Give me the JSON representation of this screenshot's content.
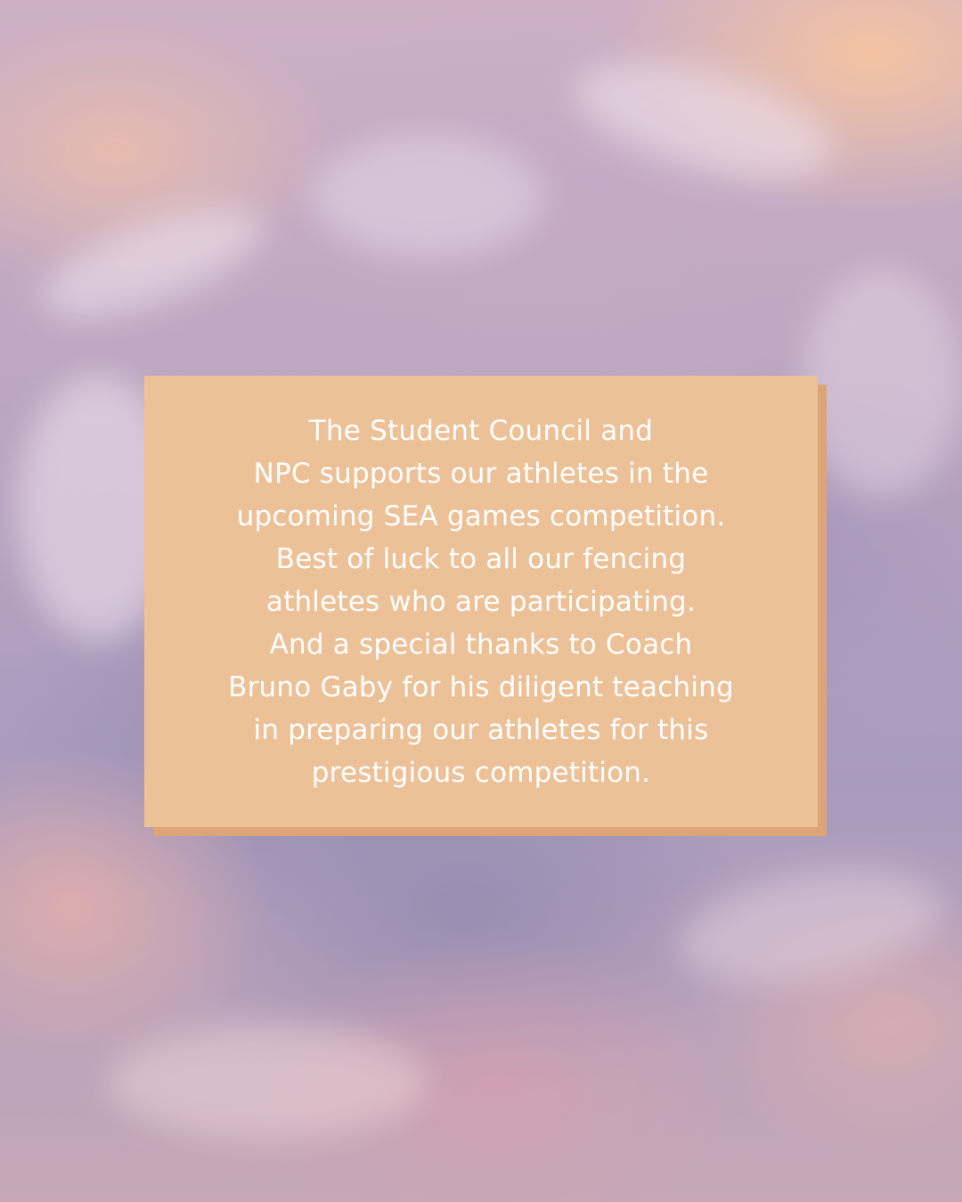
{
  "post": {
    "message_lines": [
      "The Student Council and",
      "NPC supports our athletes in the",
      "upcoming SEA games competition.",
      "Best of luck to all our fencing",
      "athletes who are participating.",
      "And a special thanks to Coach",
      "Bruno Gaby for his diligent teaching",
      "in preparing our athletes for this",
      "prestigious competition."
    ]
  },
  "colors": {
    "card_fill": "#edc198",
    "card_shadow": "#dba578",
    "text": "#ffffff"
  }
}
